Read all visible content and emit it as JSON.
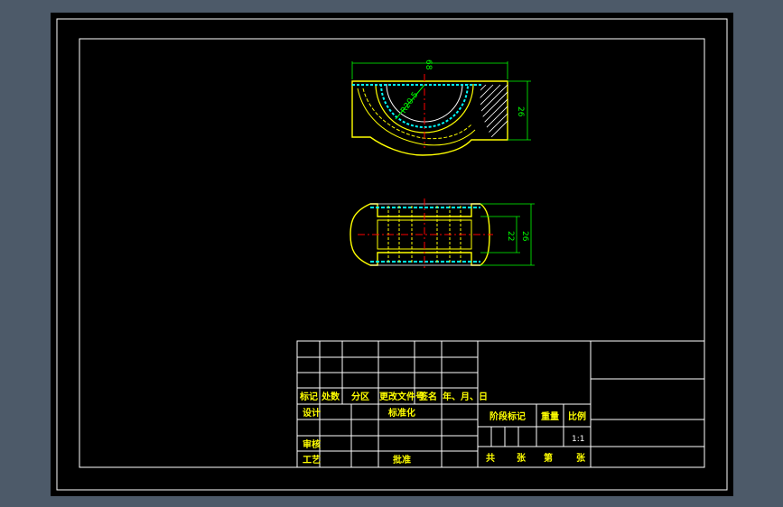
{
  "colors": {
    "background": "#4d5a69",
    "canvas": "#000000",
    "frame": "#ffffff",
    "part_outline": "#ffff00",
    "dimension": "#00ff00",
    "centerline": "#ff0000",
    "hatch": "#ffffff",
    "bearing_layer": "#00ffff"
  },
  "dimensions": {
    "top_width": "68",
    "top_height": "26",
    "top_radius": "R20.5",
    "side_inner": "22",
    "side_outer": "26"
  },
  "title_block": {
    "rev_headers": {
      "mark": "标记",
      "count": "处数",
      "zone": "分区",
      "change_doc": "更改文件号",
      "signature": "签名",
      "date": "年、月、日"
    },
    "roles": {
      "design": "设计",
      "standardization": "标准化",
      "review": "审核",
      "process": "工艺",
      "approve": "批准"
    },
    "stage": {
      "stage_mark": "阶段标记",
      "weight": "重量",
      "scale_label": "比例",
      "scale_value": "1:1"
    },
    "sheets": {
      "total": "共",
      "sheet_unit": "张",
      "nth": "第",
      "sheet_unit2": "张"
    }
  }
}
